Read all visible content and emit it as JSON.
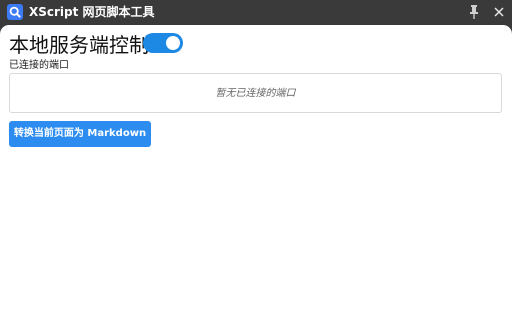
{
  "titlebar": {
    "title": "XScript 网页脚本工具",
    "app_icon": "search-icon",
    "pin_icon": "pin-icon",
    "close_icon": "close-icon"
  },
  "main": {
    "title": "本地服务端控制",
    "toggle_state": "on",
    "ports_label": "已连接的端口",
    "ports_empty_text": "暂无已连接的端口",
    "convert_button_label": "转换当前页面为 Markdown"
  },
  "colors": {
    "titlebar_bg": "#3a3a3a",
    "accent": "#2d8cf0",
    "toggle_on": "#1e88e5",
    "app_icon_bg": "#3b7bf6"
  }
}
